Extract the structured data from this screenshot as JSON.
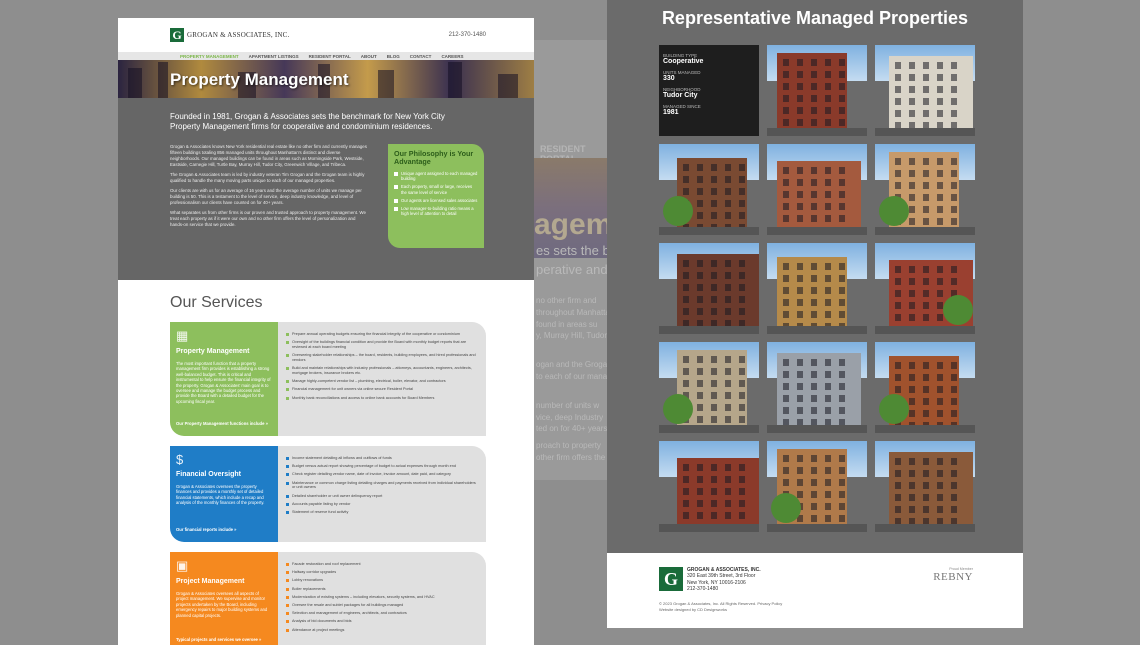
{
  "background_page": {
    "nav": "RESIDENT PORTAL",
    "title": "agemen",
    "texts": [
      "es sets the b",
      "perative and",
      "no other firm and",
      "throughout Manhatta",
      "found in areas su",
      "y, Murray Hill, Tudor",
      "ogan and the Grogan",
      "to each of our manag",
      "number of units w",
      "vice, deep Industry",
      "ted on for 40+ years.",
      "proach to property",
      "other firm offers the"
    ]
  },
  "left_page": {
    "logo_text": "GROGAN & ASSOCIATES, INC.",
    "phone": "212-370-1480",
    "nav": [
      "PROPERTY MANAGEMENT",
      "APARTMENT LISTINGS",
      "RESIDENT PORTAL",
      "ABOUT",
      "BLOG",
      "CONTACT",
      "CAREERS"
    ],
    "hero_title": "Property Management",
    "lead": "Founded in 1981, Grogan & Associates sets the benchmark for New York City Property Management firms for cooperative and condominium residences.",
    "body": [
      "Grogan & Associates knows New York residential real estate like no other firm and currently manages fifteen buildings totaling 856 managed units throughout Manhattan's distinct and diverse neighborhoods. Our managed buildings can be found in areas such as Morningside Park, Westside, Eastside, Carnegie Hill, Turtle Bay, Murray Hill, Tudor City, Greenwich Village, and Tribeca.",
      "The Grogan & Associates team is led by industry veteran Tim Grogan and the Grogan team is highly qualified to handle the many moving parts unique to each of our managed properties.",
      "Our clients are with us for an average of 16 years and the average number of units we manage per building is 50. This is a testament to the level of service, deep industry knowledge, and level of professionalism our clients have counted on for 40+ years.",
      "What separates us from other firms is our proven and trusted approach to property management. We treat each property as if it were our own and no other firm offers the level of personalization and hands-on service that we provide."
    ],
    "philosophy": {
      "title": "Our Philosophy is Your Advantage",
      "items": [
        "Unique agent assigned to each managed building",
        "Each property, small or large, receives the same level of service",
        "Our agents are licensed sales associates",
        "Low manager-to-building ratio means a high level of attention to detail"
      ]
    },
    "services_title": "Our Services",
    "services": [
      {
        "name": "Property Management",
        "desc": "The most important function that a property management firm provides is establishing a strong well-balanced budget. This is critical and instrumental to help ensure the financial integrity of the property. Grogan & Associates' main goal is to oversee and manage the budget process and provide the Board with a detailed budget for the upcoming fiscal year.",
        "link": "Our Property Management functions include »",
        "bullets": [
          "Prepare annual operating budgets ensuring the financial integrity of the cooperative or condominium",
          "Oversight of the buildings financial condition and provide the Board with monthly budget reports that are reviewed at each board meeting",
          "Overseeing stakeholder relationships – the board, residents, building employees, and hired professionals and vendors",
          "Build and maintain relationships with industry professionals – attorneys, accountants, engineers, architects, mortgage brokers, insurance brokers etc.",
          "Manage highly-competent vendor list – plumbing, electrical, boiler, elevator, and contractors",
          "Financial management for unit owners via online secure Resident Portal",
          "Monthly bank reconciliations and access to online bank accounts for Board Members"
        ]
      },
      {
        "name": "Financial Oversight",
        "desc": "Grogan & Associates oversees the property finances and provides a monthly set of detailed financial statements, which include a recap and analysis of the monthly finances of the property.",
        "link": "Our financial reports include »",
        "bullets": [
          "Income statement detailing all inflows and outflows of funds",
          "Budget versus actual report showing percentage of budget to actual expenses through month end",
          "Check register detailing vendor name, date of invoice, invoice amount, date paid, and category",
          "Maintenance or common charge listing detailing charges and payments received from individual shareholders or unit owners",
          "Detailed shareholder or unit owner delinquency report",
          "Accounts payable listing by vendor",
          "Statement of reserve fund activity"
        ]
      },
      {
        "name": "Project Management",
        "desc": "Grogan & Associates oversees all aspects of project management. We supervise and monitor projects undertaken by the Board, including emergency repairs to major building systems and planned capital projects.",
        "link": "Typical projects and services we oversee »",
        "bullets": [
          "Facade restoration and roof replacement",
          "Hallway corridor upgrades",
          "Lobby renovations",
          "Boiler replacements",
          "Modernization of existing systems – including elevators, security systems, and HVAC",
          "Oversee the resale and sublet packages for all buildings managed",
          "Selection and management of engineers, architects, and contractors",
          "Analysis of bid documents and bids",
          "Attendance at project meetings"
        ]
      }
    ]
  },
  "right_page": {
    "title": "Representative Managed Properties",
    "info": {
      "building_type_label": "BUILDING TYPE",
      "building_type": "Cooperative",
      "units_label": "UNITS MANAGED",
      "units": "330",
      "neighborhood_label": "NEIGHBORHOOD",
      "neighborhood": "Tudor City",
      "since_label": "MANAGED SINCE",
      "since": "1981"
    },
    "footer": {
      "name": "GROGAN & ASSOCIATES, INC.",
      "address1": "320 East 39th Street, 3rd Floor",
      "address2": "New York, NY 10016-2106",
      "phone": "212-370-1480",
      "copyright": "© 2023 Grogan & Associates, Inc. All Rights Reserved. Privacy Policy",
      "designer": "Website designed by CD Designworks",
      "member_label": "Proud Member",
      "rebny": "REBNY"
    }
  }
}
